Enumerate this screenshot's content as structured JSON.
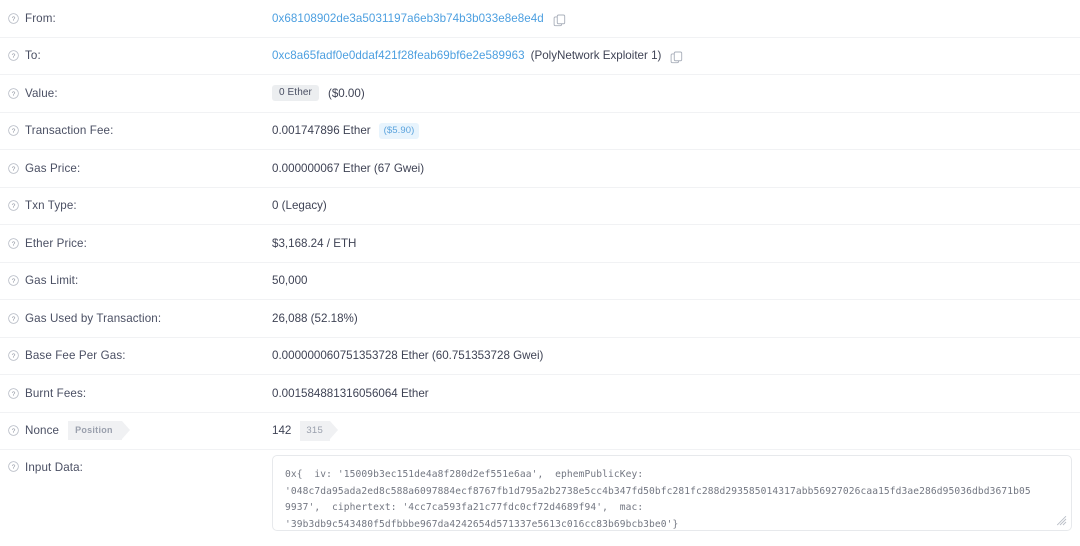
{
  "icons": {
    "help": "question-circle-icon",
    "copy": "copy-icon"
  },
  "rows": {
    "from": {
      "label": "From:",
      "address": "0x68108902de3a5031197a6eb3b74b3b033e8e8e4d"
    },
    "to": {
      "label": "To:",
      "address": "0xc8a65fadf0e0ddaf421f28feab69bf6e2e589963",
      "name_tag": "(PolyNetwork Exploiter 1)"
    },
    "value": {
      "label": "Value:",
      "amount_badge": "0 Ether",
      "fiat": "($0.00)"
    },
    "transaction_fee": {
      "label": "Transaction Fee:",
      "amount": "0.001747896 Ether",
      "fiat_badge": "($5.90)"
    },
    "gas_price": {
      "label": "Gas Price:",
      "value": "0.000000067 Ether (67 Gwei)"
    },
    "txn_type": {
      "label": "Txn Type:",
      "value": "0 (Legacy)"
    },
    "ether_price": {
      "label": "Ether Price:",
      "value": "$3,168.24 / ETH"
    },
    "gas_limit": {
      "label": "Gas Limit:",
      "value": "50,000"
    },
    "gas_used": {
      "label": "Gas Used by Transaction:",
      "value": "26,088 (52.18%)"
    },
    "base_fee_per_gas": {
      "label": "Base Fee Per Gas:",
      "value": "0.000000060751353728 Ether (60.751353728 Gwei)"
    },
    "burnt_fees": {
      "label": "Burnt Fees:",
      "value": "0.001584881316056064 Ether"
    },
    "nonce": {
      "label": "Nonce",
      "position_badge": "Position",
      "value": "142",
      "index_badge": "315"
    },
    "input_data": {
      "label": "Input Data:",
      "text": "0x{  iv: '15009b3ec151de4a8f280d2ef551e6aa',  ephemPublicKey:\n'048c7da95ada2ed8c588a6097884ecf8767fb1d795a2b2738e5cc4b347fd50bfc281fc288d293585014317abb56927026caa15fd3ae286d95036dbd3671b05\n9937',  ciphertext: '4cc7ca593fa21c77fdc0cf72d4689f94',  mac:\n'39b3db9c543480f5dfbbbe967da4242654d571337e5613c016cc83b69bcb3be0'}"
    }
  },
  "colors": {
    "link": "#4c9fe0",
    "text": "#3f4355",
    "muted": "#9aa0ad",
    "divider": "#f1f2f4",
    "badge_gray_bg": "#eceef0",
    "badge_blue_bg": "#e8f4fd",
    "badge_blue_text": "#5ba3dd"
  }
}
